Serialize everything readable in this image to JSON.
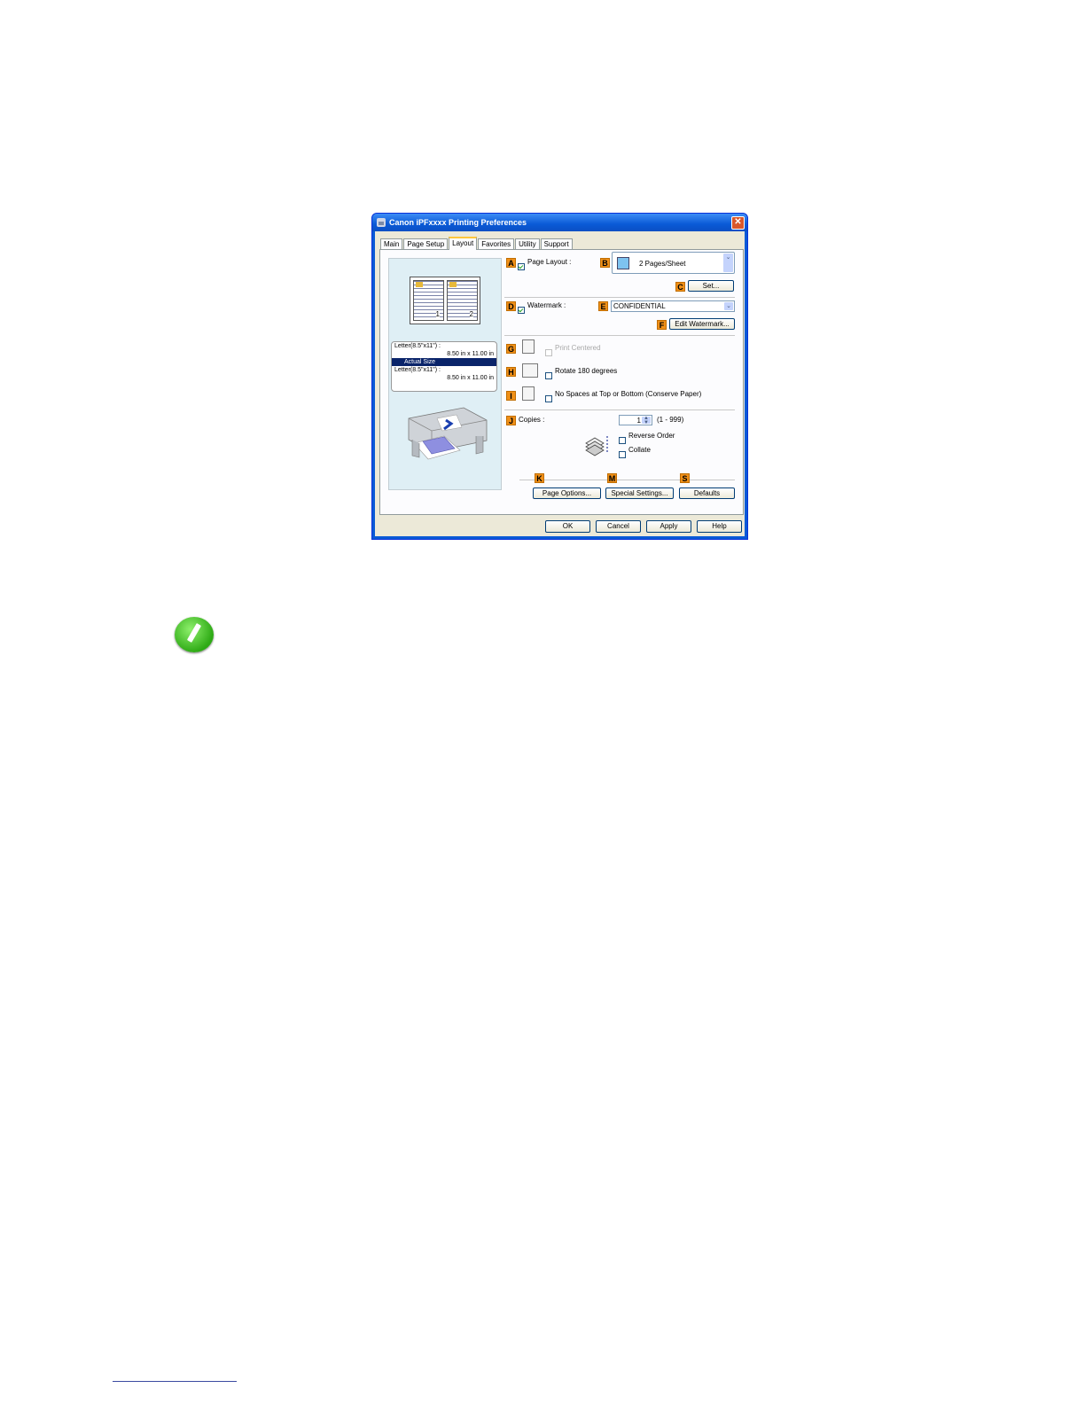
{
  "dialog": {
    "title": "Canon iPFxxxx Printing Preferences",
    "tabs": [
      "Main",
      "Page Setup",
      "Layout",
      "Favorites",
      "Utility",
      "Support"
    ],
    "active_tab": "Layout"
  },
  "preview": {
    "page_numbers": [
      "1",
      "2"
    ],
    "size_lines": [
      "Letter(8.5\"x11\") :",
      "8.50 in x 11.00 in",
      "Actual Size",
      "Letter(8.5\"x11\") :",
      "8.50 in x 11.00 in"
    ]
  },
  "markers": {
    "A": "A",
    "B": "B",
    "C": "C",
    "D": "D",
    "E": "E",
    "F": "F",
    "G": "G",
    "H": "H",
    "I": "I",
    "J": "J",
    "K": "K",
    "M": "M",
    "S": "S"
  },
  "layout": {
    "page_layout_label": "Page Layout :",
    "page_layout_checked": true,
    "pages_per_sheet": "2 Pages/Sheet",
    "set_button": "Set...",
    "watermark_label": "Watermark :",
    "watermark_checked": true,
    "watermark_value": "CONFIDENTIAL",
    "edit_watermark_button": "Edit Watermark...",
    "print_centered_label": "Print Centered",
    "rotate_label": "Rotate 180 degrees",
    "no_spaces_label": "No Spaces at Top or Bottom (Conserve Paper)",
    "copies_label": "Copies :",
    "copies_value": "1",
    "copies_range": "(1 - 999)",
    "reverse_order_label": "Reverse Order",
    "collate_label": "Collate",
    "page_options_button": "Page Options...",
    "special_settings_button": "Special Settings...",
    "defaults_button": "Defaults"
  },
  "footer_buttons": {
    "ok": "OK",
    "cancel": "Cancel",
    "apply": "Apply",
    "help": "Help"
  },
  "colors": {
    "titlebar": "#0a5ad6",
    "marker": "#f09018",
    "note_icon": "#2eaa15"
  },
  "icons": [
    "printer-icon",
    "close-icon",
    "note-pencil-icon"
  ]
}
